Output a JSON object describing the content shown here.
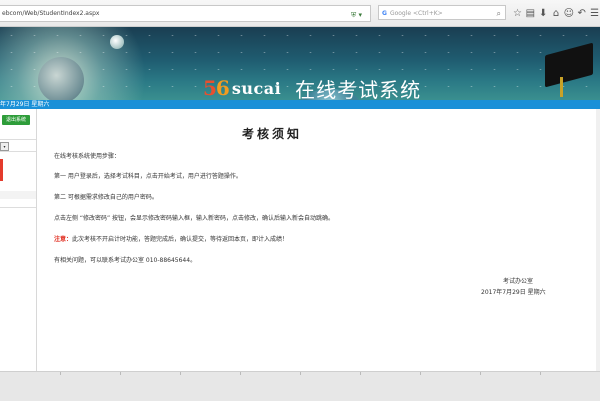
{
  "browser": {
    "url": "ebcom/Web/StudentIndex2.aspx",
    "search_placeholder": "Google <Ctrl+K>",
    "search_engine_glyph": "G"
  },
  "banner": {
    "logo_digit_5": "5",
    "logo_digit_6": "6",
    "logo_brand": "sucai",
    "system_title": "在线考试系统"
  },
  "datebar": {
    "text": "年7月29日 星期六"
  },
  "sidebar": {
    "top_button_label": "退出系统",
    "select_arrow": "▾"
  },
  "main": {
    "title": "考核须知",
    "intro": "在线考核系统使用步骤：",
    "step1": "第一  用户登录后，选择考试科目，点击开始考试，用户进行答题操作。",
    "step2": "第二  可根据需求修改自己的用户密码。",
    "password_tip": "点击左侧 “修改密码” 按钮，会显示修改密码输入框，输入新密码，点击修改，确认后输入新会自动跳确。",
    "note_label": "注意：",
    "note_text": "此次考核不开启计时功能，答题完成后，确认提交，等待返回本页，即计入成绩！",
    "contact": "有相关问题，可以联系考试办公室 010-88645644。",
    "signature_office": "考试办公室",
    "signature_date": "2017年7月29日 星期六"
  },
  "colors": {
    "datebar": "#1a90d8",
    "side_button": "#2e9d3a",
    "note_red": "#e02a1c"
  }
}
